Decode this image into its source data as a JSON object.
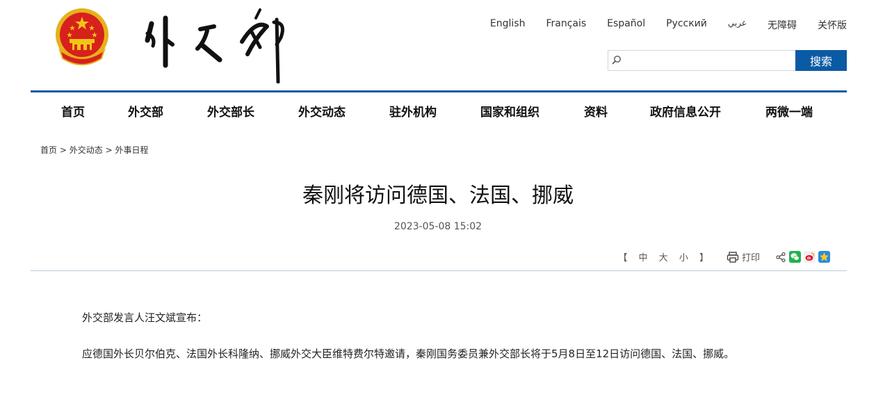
{
  "header": {
    "languages": [
      "English",
      "Français",
      "Español",
      "Русский",
      "عربي",
      "无障碍",
      "关怀版"
    ],
    "search": {
      "placeholder": "",
      "button_label": "搜索"
    }
  },
  "nav": {
    "items": [
      "首页",
      "外交部",
      "外交部长",
      "外交动态",
      "驻外机构",
      "国家和组织",
      "资料",
      "政府信息公开",
      "两微一端"
    ]
  },
  "breadcrumb": [
    "首页",
    "外交动态",
    "外事日程"
  ],
  "article": {
    "title": "秦刚将访问德国、法国、挪威",
    "date": "2023-05-08 15:02",
    "paragraphs": [
      "外交部发言人汪文斌宣布：",
      "应德国外长贝尔伯克、法国外长科隆纳、挪威外交大臣维特费尔特邀请，秦刚国务委员兼外交部长将于5月8日至12日访问德国、法国、挪威。"
    ]
  },
  "tools": {
    "bracket_open": "【",
    "font_sizes": [
      "中",
      "大",
      "小"
    ],
    "bracket_close": "】",
    "print_label": "打印"
  },
  "colors": {
    "brand_blue": "#0b5aa4",
    "emblem_red": "#d8201c",
    "emblem_gold": "#f2c418"
  }
}
